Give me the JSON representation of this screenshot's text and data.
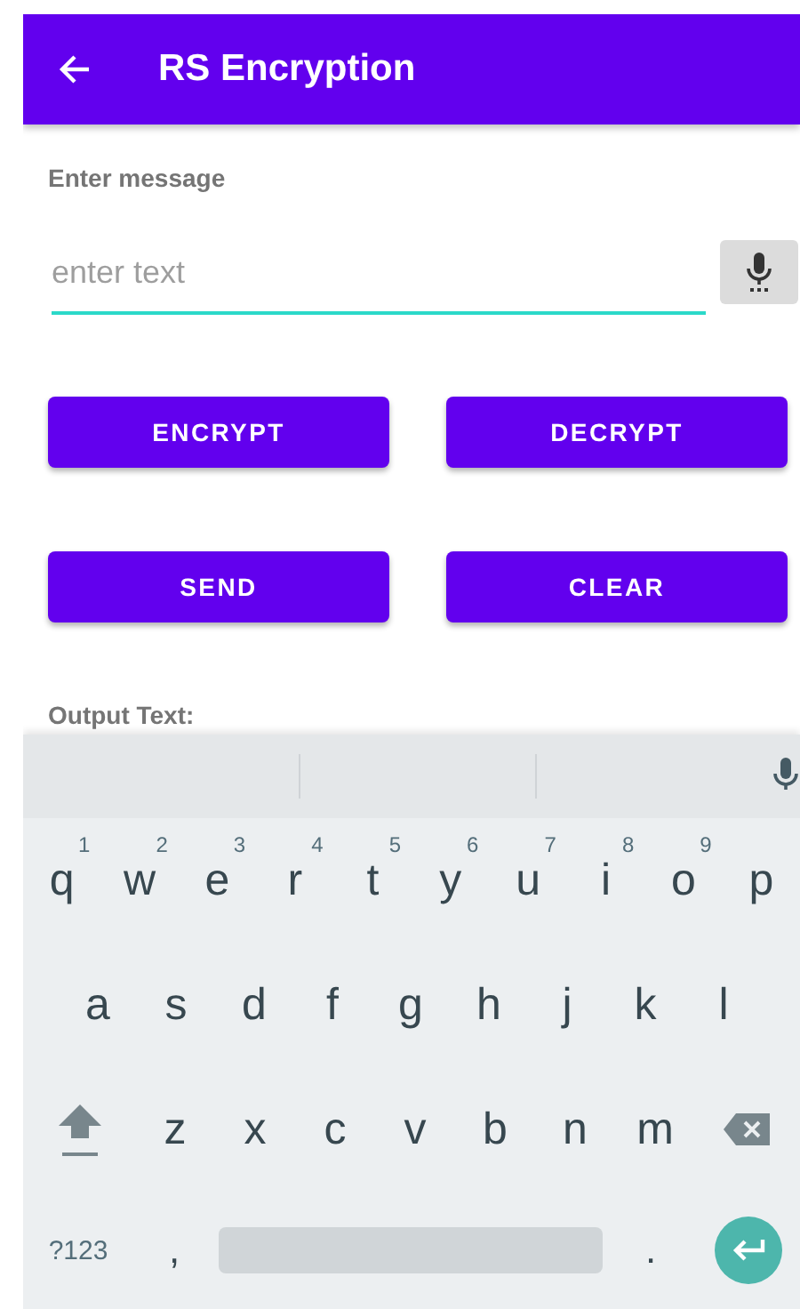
{
  "app_bar": {
    "title": "RS Encryption"
  },
  "form": {
    "label": "Enter message",
    "input": {
      "placeholder": "enter text"
    }
  },
  "buttons": [
    {
      "label": "ENCRYPT"
    },
    {
      "label": "DECRYPT"
    },
    {
      "label": "SEND"
    },
    {
      "label": "CLEAR"
    }
  ],
  "output_label": "Output Text:",
  "keyboard": {
    "rows": [
      {
        "keys": [
          {
            "kind": "letter",
            "label": "q",
            "hint": "1"
          },
          {
            "kind": "letter",
            "label": "w",
            "hint": "2"
          },
          {
            "kind": "letter",
            "label": "e",
            "hint": "3"
          },
          {
            "kind": "letter",
            "label": "r",
            "hint": "4"
          },
          {
            "kind": "letter",
            "label": "t",
            "hint": "5"
          },
          {
            "kind": "letter",
            "label": "y",
            "hint": "6"
          },
          {
            "kind": "letter",
            "label": "u",
            "hint": "7"
          },
          {
            "kind": "letter",
            "label": "i",
            "hint": "8"
          },
          {
            "kind": "letter",
            "label": "o",
            "hint": "9"
          },
          {
            "kind": "letter",
            "label": "p"
          }
        ]
      },
      {
        "keys": [
          {
            "kind": "letter",
            "label": "a"
          },
          {
            "kind": "letter",
            "label": "s"
          },
          {
            "kind": "letter",
            "label": "d"
          },
          {
            "kind": "letter",
            "label": "f"
          },
          {
            "kind": "letter",
            "label": "g"
          },
          {
            "kind": "letter",
            "label": "h"
          },
          {
            "kind": "letter",
            "label": "j"
          },
          {
            "kind": "letter",
            "label": "k"
          },
          {
            "kind": "letter",
            "label": "l"
          }
        ]
      },
      {
        "keys": [
          {
            "kind": "shift"
          },
          {
            "kind": "letter",
            "label": "z"
          },
          {
            "kind": "letter",
            "label": "x"
          },
          {
            "kind": "letter",
            "label": "c"
          },
          {
            "kind": "letter",
            "label": "v"
          },
          {
            "kind": "letter",
            "label": "b"
          },
          {
            "kind": "letter",
            "label": "n"
          },
          {
            "kind": "letter",
            "label": "m"
          },
          {
            "kind": "backspace"
          }
        ]
      },
      {
        "keys": [
          {
            "kind": "symbols",
            "label": "?123"
          },
          {
            "kind": "comma",
            "label": ","
          },
          {
            "kind": "space"
          },
          {
            "kind": "period",
            "label": "."
          },
          {
            "kind": "enter"
          }
        ]
      }
    ]
  }
}
